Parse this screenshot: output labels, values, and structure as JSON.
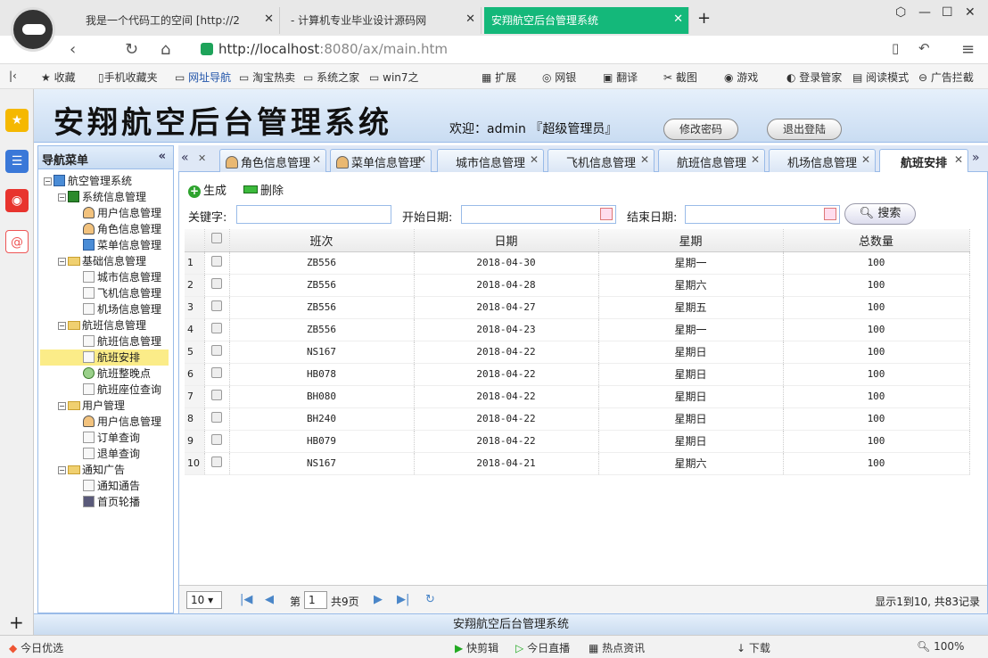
{
  "browser": {
    "tabs": [
      {
        "title": "我是一个代码工的空间 [http://2",
        "active": false
      },
      {
        "title": "- 计算机专业毕业设计源码网",
        "active": false
      },
      {
        "title": "安翔航空后台管理系统",
        "active": true
      }
    ],
    "new_tab": "+",
    "url_host": "http://localhost",
    "url_rest": ":8080/ax/main.htm",
    "bookmarks": [
      "收藏",
      "手机收藏夹",
      "网址导航",
      "淘宝热卖",
      "系统之家",
      "win7之"
    ],
    "toolbar_items": [
      "扩展",
      "网银",
      "翻译",
      "截图",
      "游戏",
      "登录管家",
      "阅读模式",
      "广告拦截"
    ]
  },
  "header": {
    "system_title": "安翔航空后台管理系统",
    "welcome": "欢迎：admin 『超级管理员』",
    "change_password": "修改密码",
    "logout": "退出登陆"
  },
  "nav": {
    "title": "导航菜单",
    "collapse": "«",
    "tree": [
      {
        "label": "航空管理系统",
        "level": 0,
        "type": "root"
      },
      {
        "label": "系统信息管理",
        "level": 1,
        "type": "folder-green"
      },
      {
        "label": "用户信息管理",
        "level": 2,
        "type": "user"
      },
      {
        "label": "角色信息管理",
        "level": 2,
        "type": "user"
      },
      {
        "label": "菜单信息管理",
        "level": 2,
        "type": "house"
      },
      {
        "label": "基础信息管理",
        "level": 1,
        "type": "folder"
      },
      {
        "label": "城市信息管理",
        "level": 2,
        "type": "doc"
      },
      {
        "label": "飞机信息管理",
        "level": 2,
        "type": "doc"
      },
      {
        "label": "机场信息管理",
        "level": 2,
        "type": "doc"
      },
      {
        "label": "航班信息管理",
        "level": 1,
        "type": "folder"
      },
      {
        "label": "航班信息管理",
        "level": 2,
        "type": "doc"
      },
      {
        "label": "航班安排",
        "level": 2,
        "type": "doc",
        "selected": true
      },
      {
        "label": "航班整晚点",
        "level": 2,
        "type": "clock"
      },
      {
        "label": "航班座位查询",
        "level": 2,
        "type": "tools"
      },
      {
        "label": "用户管理",
        "level": 1,
        "type": "folder"
      },
      {
        "label": "用户信息管理",
        "level": 2,
        "type": "user"
      },
      {
        "label": "订单查询",
        "level": 2,
        "type": "doc"
      },
      {
        "label": "退单查询",
        "level": 2,
        "type": "grid"
      },
      {
        "label": "通知广告",
        "level": 1,
        "type": "folder"
      },
      {
        "label": "通知通告",
        "level": 2,
        "type": "doc"
      },
      {
        "label": "首页轮播",
        "level": 2,
        "type": "img"
      }
    ]
  },
  "tabs": [
    {
      "label": "角色信息管理",
      "icon": true
    },
    {
      "label": "菜单信息管理",
      "icon": true
    },
    {
      "label": "城市信息管理",
      "icon": false
    },
    {
      "label": "飞机信息管理",
      "icon": false
    },
    {
      "label": "航班信息管理",
      "icon": false
    },
    {
      "label": "机场信息管理",
      "icon": false
    },
    {
      "label": "航班安排",
      "icon": false,
      "active": true
    }
  ],
  "toolbar": {
    "generate": "生成",
    "delete": "删除"
  },
  "filters": {
    "keyword_label": "关键字:",
    "start_label": "开始日期:",
    "end_label": "结束日期:",
    "search": "搜索"
  },
  "grid": {
    "columns": [
      "班次",
      "日期",
      "星期",
      "总数量"
    ],
    "rows": [
      {
        "n": "1",
        "flight": "ZB556",
        "date": "2018-04-30",
        "weekday": "星期一",
        "total": "100"
      },
      {
        "n": "2",
        "flight": "ZB556",
        "date": "2018-04-28",
        "weekday": "星期六",
        "total": "100"
      },
      {
        "n": "3",
        "flight": "ZB556",
        "date": "2018-04-27",
        "weekday": "星期五",
        "total": "100"
      },
      {
        "n": "4",
        "flight": "ZB556",
        "date": "2018-04-23",
        "weekday": "星期一",
        "total": "100"
      },
      {
        "n": "5",
        "flight": "NS167",
        "date": "2018-04-22",
        "weekday": "星期日",
        "total": "100"
      },
      {
        "n": "6",
        "flight": "HB078",
        "date": "2018-04-22",
        "weekday": "星期日",
        "total": "100"
      },
      {
        "n": "7",
        "flight": "BH080",
        "date": "2018-04-22",
        "weekday": "星期日",
        "total": "100"
      },
      {
        "n": "8",
        "flight": "BH240",
        "date": "2018-04-22",
        "weekday": "星期日",
        "total": "100"
      },
      {
        "n": "9",
        "flight": "HB079",
        "date": "2018-04-22",
        "weekday": "星期日",
        "total": "100"
      },
      {
        "n": "10",
        "flight": "NS167",
        "date": "2018-04-21",
        "weekday": "星期六",
        "total": "100"
      }
    ]
  },
  "pager": {
    "page_size": "10",
    "page_label": "第",
    "page": "1",
    "total_pages": "共9页",
    "info": "显示1到10, 共83记录"
  },
  "footer": "安翔航空后台管理系统",
  "status": {
    "left": "今日优选",
    "items": [
      "快剪辑",
      "今日直播",
      "热点资讯",
      "下载"
    ],
    "zoom": "100%"
  }
}
